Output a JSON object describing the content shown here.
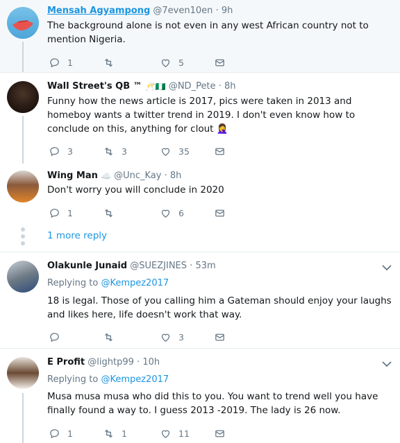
{
  "tweets": [
    {
      "name": "Mensah Agyampong",
      "handle": "@7even10en",
      "time": "9h",
      "text": "The background alone is not even in any west African country not to mention Nigeria.",
      "replies": "1",
      "retweets": "",
      "likes": "5"
    },
    {
      "name": "Wall Street's QB ™",
      "badges": "🥂🇳🇬",
      "handle": "@ND_Pete",
      "time": "8h",
      "text": "Funny how the news article is 2017, pics were taken in 2013 and homeboy wants a twitter trend in 2019. I don't even know how to conclude on this, anything for clout 🤦‍♀️",
      "replies": "3",
      "retweets": "3",
      "likes": "35"
    },
    {
      "name": "Wing Man",
      "badges": "☁️",
      "handle": "@Unc_Kay",
      "time": "8h",
      "text": "Don't worry you will conclude in 2020",
      "replies": "1",
      "retweets": "",
      "likes": "6"
    },
    {
      "name": "Olakunle Junaid",
      "handle": "@SUEZJINES",
      "time": "53m",
      "replying_label": "Replying to",
      "replying_to": "@Kempez2017",
      "text": "18 is legal. Those of you calling him a Gateman should enjoy your laughs and likes here, life doesn't work that way.",
      "replies": "",
      "retweets": "",
      "likes": "3"
    },
    {
      "name": "E Profit",
      "handle": "@lightp99",
      "time": "10h",
      "replying_label": "Replying to",
      "replying_to": "@Kempez2017",
      "text": "Musa musa musa who did this to you. You want to trend well you have finally found a way to. I guess 2013 -2019. The lady is 26 now.",
      "replies": "1",
      "retweets": "1",
      "likes": "11"
    }
  ],
  "more_reply": "1 more reply",
  "sep_dot": "·"
}
